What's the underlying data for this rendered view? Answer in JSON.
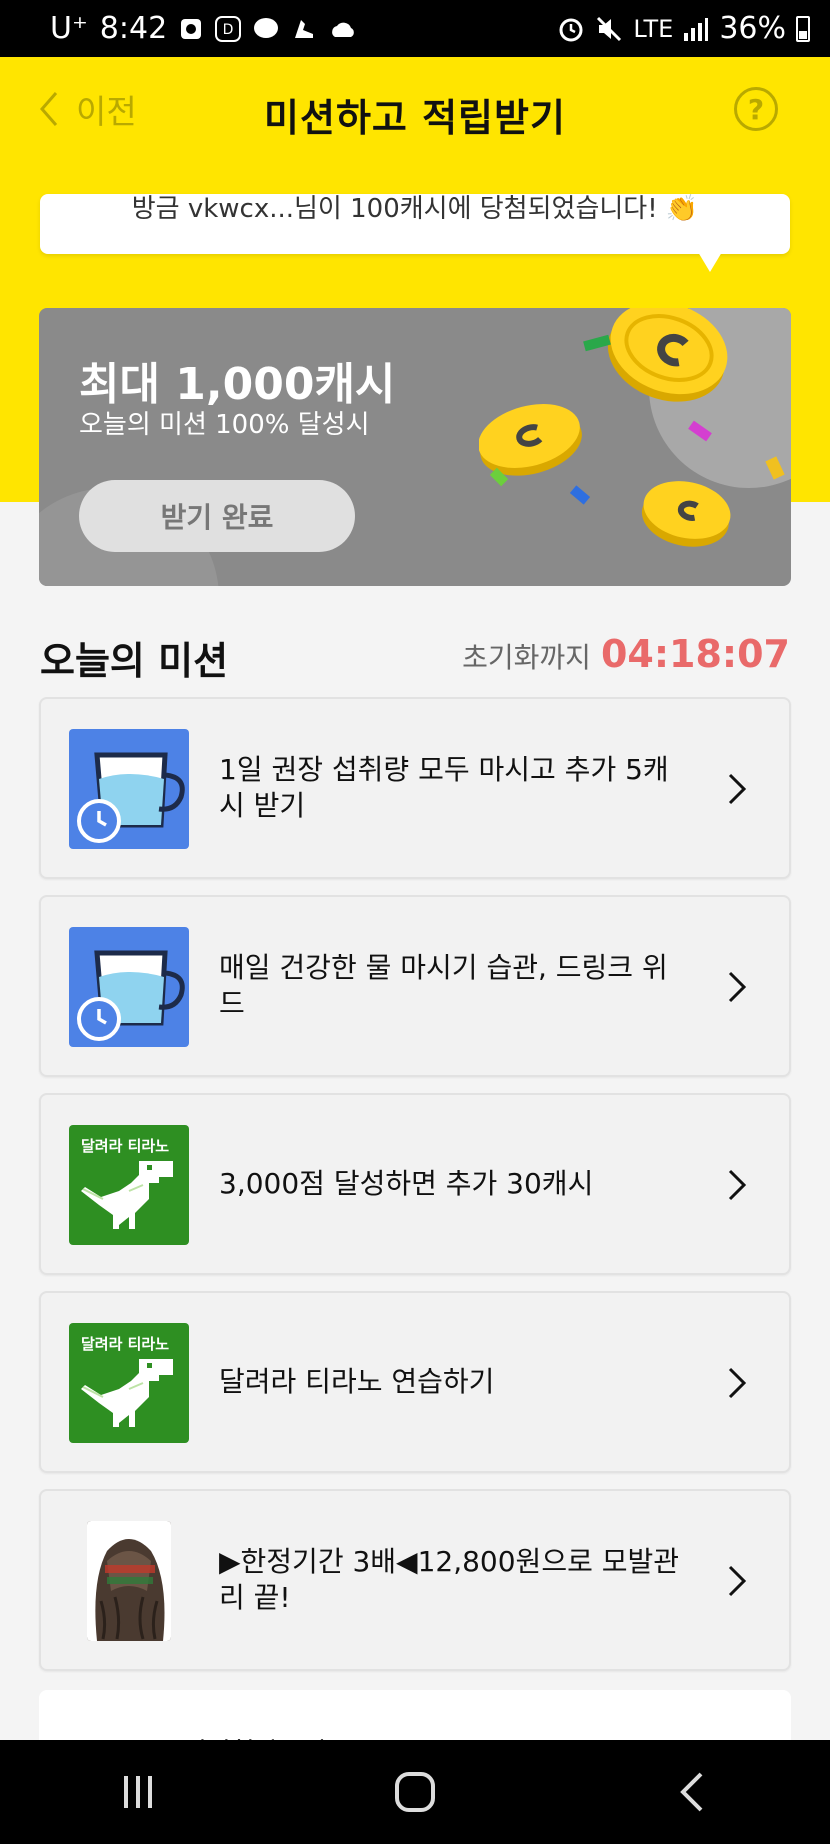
{
  "status_bar": {
    "carrier": "U⁺",
    "time": "8:42",
    "network": "LTE",
    "battery": "36%"
  },
  "header": {
    "back_label": "이전",
    "title": "미션하고 적립받기",
    "help_label": "?"
  },
  "ticker": {
    "text": "방금 vkwcx...님이 100캐시에 당첨되었습니다! 👏"
  },
  "reward_card": {
    "title": "최대 1,000캐시",
    "subtitle": "오늘의 미션 100% 달성시",
    "button_label": "받기 완료"
  },
  "missions_section": {
    "title": "오늘의 미션",
    "reset_label": "초기화까지",
    "reset_time": "04:18:07"
  },
  "missions": [
    {
      "text": "1일 권장 섭취량 모두 마시고 추가 5캐시 받기",
      "icon": "water-cup-alarm-icon"
    },
    {
      "text": "매일 건강한 물 마시기 습관, 드링크 위드",
      "icon": "water-cup-alarm-icon"
    },
    {
      "text": "3,000점 달성하면 추가 30캐시",
      "icon": "dino-game-icon",
      "icon_label": "달려라 티라노"
    },
    {
      "text": "달려라 티라노 연습하기",
      "icon": "dino-game-icon",
      "icon_label": "달려라 티라노"
    },
    {
      "text": "▶한정기간 3배◀12,800원으로 모발관리 끝!",
      "icon": "hair-ad-thumbnail"
    }
  ],
  "partial_item": {
    "text": "도서신청자들님"
  },
  "colors": {
    "brand_yellow": "#ffe500",
    "timer_red": "#e96a6a",
    "card_gray": "#8a8a8a"
  }
}
